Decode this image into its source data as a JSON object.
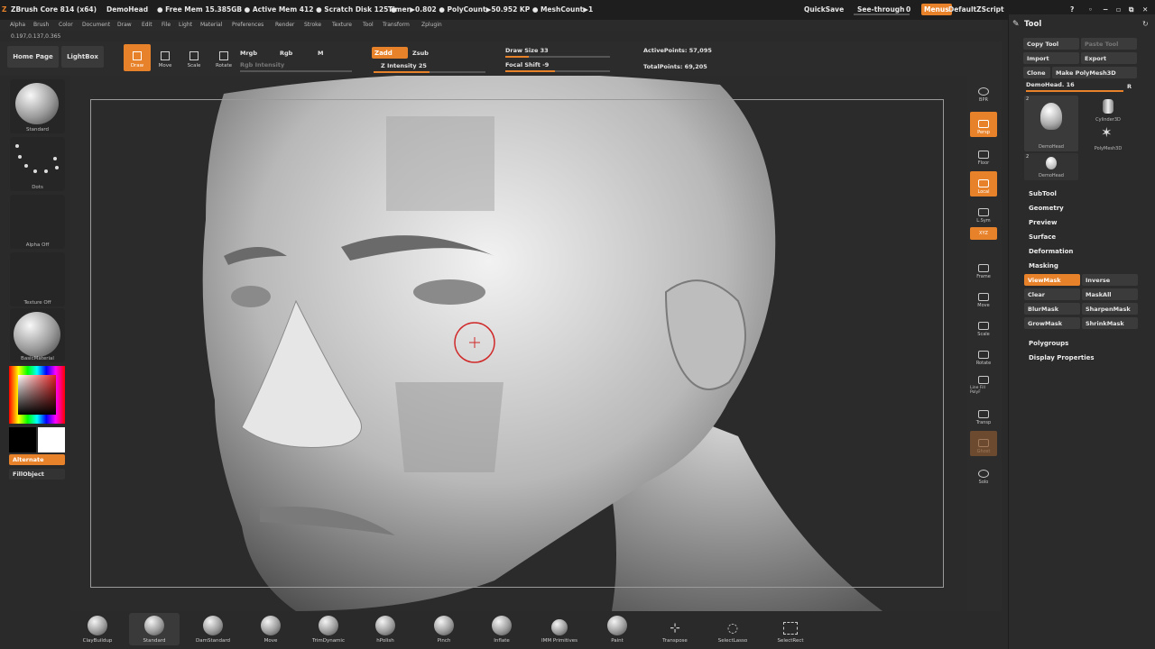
{
  "titlebar": {
    "app": "ZBrush Core 814 (x64)",
    "doc": "DemoHead",
    "stats": "● Free Mem 15.385GB ● Active Mem 412 ● Scratch Disk 125 ●",
    "timer": "Timer▶0.802 ● PolyCount▶50.952 KP ● MeshCount▶1",
    "quicksave": "QuickSave",
    "seethrough": "See-through",
    "seethrough_value": "0",
    "menus": "Menus",
    "script": "DefaultZScript"
  },
  "menubar": [
    "Alpha",
    "Brush",
    "Color",
    "Document",
    "Draw",
    "Edit",
    "File",
    "Light",
    "Material",
    "Preferences",
    "Render",
    "Stroke",
    "Texture",
    "Tool",
    "Transform",
    "Zplugin"
  ],
  "coords": "0.197,0.137,0.365",
  "shelf": {
    "home": "Home Page",
    "lightbox": "LightBox",
    "draw": "Draw",
    "move": "Move",
    "scale": "Scale",
    "rotate": "Rotate",
    "mrgb": "Mrgb",
    "rgb": "Rgb",
    "m": "M",
    "rgb_intensity": "Rgb Intensity",
    "zadd": "Zadd",
    "zsub": "Zsub",
    "z_intensity": "Z Intensity 25",
    "draw_size": "Draw Size 33",
    "focal_shift": "Focal Shift -9",
    "active_points": "ActivePoints: 57,095",
    "total_points": "TotalPoints: 69,205"
  },
  "lefttray": {
    "brush": "Standard",
    "stroke": "Dots",
    "alpha": "Alpha Off",
    "texture": "Texture Off",
    "material": "BasicMaterial",
    "alternate": "Alternate",
    "fillobject": "FillObject"
  },
  "rightshelf": [
    "BPR",
    "Persp",
    "Floor",
    "Local",
    "L.Sym",
    "XYZ",
    "Frame",
    "Move",
    "Scale",
    "Rotate",
    "Line Fill PolyF",
    "Transp",
    "Ghost",
    "Solo"
  ],
  "toolpanel": {
    "title": "Tool",
    "copy_tool": "Copy Tool",
    "paste_tool": "Paste Tool",
    "import": "Import",
    "export": "Export",
    "clone": "Clone",
    "make_polymesh": "Make PolyMesh3D",
    "current": "DemoHead. 16",
    "r": "R",
    "thumb_count_1": "2",
    "thumb_count_2": "2",
    "thumbs": [
      "DemoHead",
      "Cylinder3D",
      "PolyMesh3D",
      "DemoHead"
    ],
    "sections": [
      "SubTool",
      "Geometry",
      "Preview",
      "Surface",
      "Deformation",
      "Masking"
    ],
    "masking": [
      "ViewMask",
      "Inverse",
      "Clear",
      "MaskAll",
      "BlurMask",
      "SharpenMask",
      "GrowMask",
      "ShrinkMask"
    ],
    "sections2": [
      "Polygroups",
      "Display Properties"
    ]
  },
  "bottomshelf": [
    "ClayBuildup",
    "Standard",
    "DamStandard",
    "Move",
    "TrimDynamic",
    "hPolish",
    "Pinch",
    "Inflate",
    "IMM Primitives",
    "Paint",
    "Transpose",
    "SelectLasso",
    "SelectRect"
  ],
  "colors": {
    "accent": "#e8822a",
    "bg": "#2a2a2a"
  }
}
